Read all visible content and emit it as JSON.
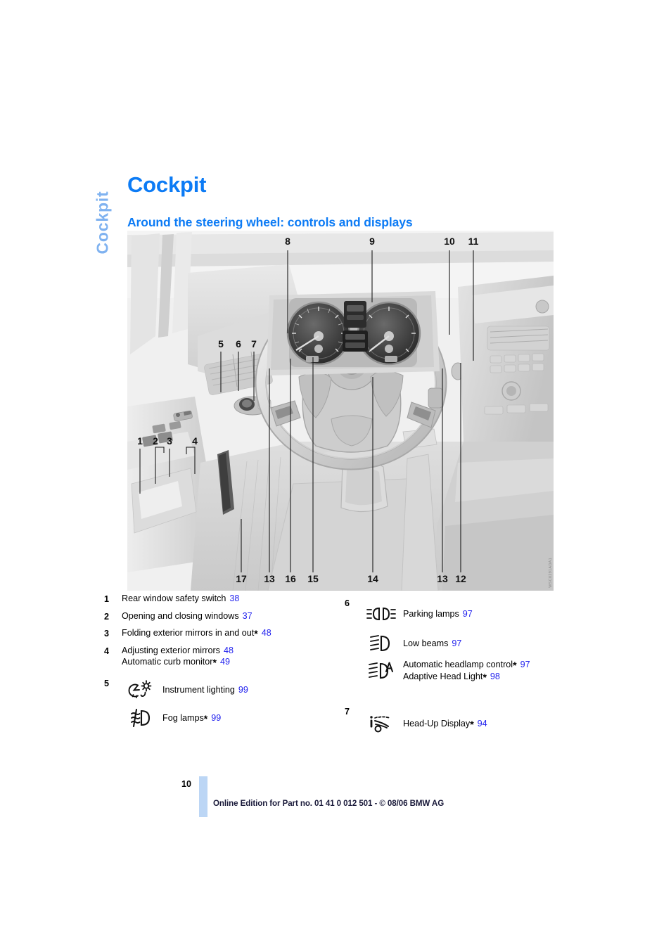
{
  "page": {
    "thumb_tab_label": "Cockpit",
    "chapter_title": "Cockpit",
    "section_title": "Around the steering wheel: controls and displays",
    "page_number": "10",
    "footer_text": "Online Edition for Part no. 01 41 0 012 501 - © 08/06 BMW AG",
    "accent_blue": "#0C7BF5",
    "tab_blue": "#7FB2F0",
    "page_ref_blue": "#2222EE",
    "footer_bar_blue": "#BCD6F5"
  },
  "illustration": {
    "alt": "BMW cockpit: steering wheel, instrument cluster, door panel switches and pedals",
    "figure_ref": "WSC0291ADA1",
    "callouts_top": [
      "8",
      "9",
      "10",
      "11"
    ],
    "callouts_mid": [
      "5",
      "6",
      "7"
    ],
    "callouts_door": [
      "1",
      "2",
      "3",
      "4"
    ],
    "callouts_bottom": [
      "17",
      "13",
      "16",
      "15",
      "14",
      "13",
      "12"
    ]
  },
  "legend": {
    "left": [
      {
        "num": "1",
        "lines": [
          {
            "text": "Rear window safety switch",
            "page": "38",
            "asterisk": false
          }
        ]
      },
      {
        "num": "2",
        "lines": [
          {
            "text": "Opening and closing windows",
            "page": "37",
            "asterisk": false
          }
        ]
      },
      {
        "num": "3",
        "lines": [
          {
            "text": "Folding exterior mirrors in and out",
            "page": "48",
            "asterisk": true
          }
        ]
      },
      {
        "num": "4",
        "lines": [
          {
            "text": "Adjusting exterior mirrors",
            "page": "48",
            "asterisk": false
          },
          {
            "text": "Automatic curb monitor",
            "page": "49",
            "asterisk": true
          }
        ]
      }
    ],
    "left_icons": [
      {
        "num": "5",
        "items": [
          {
            "icon": "instrument-lighting-icon",
            "lines": [
              {
                "text": "Instrument lighting",
                "page": "99",
                "asterisk": false
              }
            ]
          },
          {
            "icon": "fog-lamps-icon",
            "lines": [
              {
                "text": "Fog lamps",
                "page": "99",
                "asterisk": true
              }
            ]
          }
        ]
      }
    ],
    "right_icons": [
      {
        "num": "6",
        "items": [
          {
            "icon": "parking-lamps-icon",
            "lines": [
              {
                "text": "Parking lamps",
                "page": "97",
                "asterisk": false
              }
            ]
          },
          {
            "icon": "low-beams-icon",
            "lines": [
              {
                "text": "Low beams",
                "page": "97",
                "asterisk": false
              }
            ]
          },
          {
            "icon": "automatic-headlamp-control-icon",
            "lines": [
              {
                "text": "Automatic headlamp control",
                "page": "97",
                "asterisk": true
              },
              {
                "text": "Adaptive Head Light",
                "page": "98",
                "asterisk": true
              }
            ]
          }
        ]
      },
      {
        "num": "7",
        "items": [
          {
            "icon": "head-up-display-icon",
            "lines": [
              {
                "text": "Head-Up Display",
                "page": "94",
                "asterisk": true
              }
            ]
          }
        ]
      }
    ]
  }
}
